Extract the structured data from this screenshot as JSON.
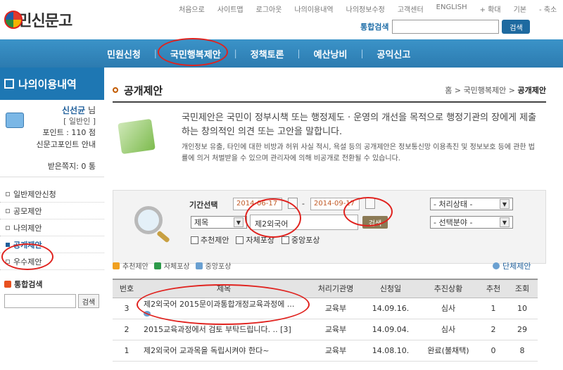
{
  "header": {
    "logo": "국민신문고",
    "util_links": [
      "처음으로",
      "사이트맵",
      "로그아웃",
      "나의이용내역",
      "나의정보수정",
      "고객센터",
      "ENGLISH",
      "+ 확대",
      "기본",
      "- 축소"
    ],
    "search_label": "통합검색",
    "search_button": "검색"
  },
  "gnb": [
    "민원신청",
    "국민행복제안",
    "정책토론",
    "예산낭비",
    "공익신고"
  ],
  "sidebar": {
    "title": "나의이용내역",
    "user_name": "신선균",
    "user_suffix": "님",
    "level": "[ 일반인 ]",
    "points": "포인트 : 110 점",
    "point_info": "신문고포인트 안내",
    "messages": "받은쪽지: 0 통",
    "menu": [
      "일반제안신청",
      "공모제안",
      "나의제안",
      "공개제안",
      "우수제안"
    ],
    "search_label": "통합검색",
    "search_button": "검색"
  },
  "main": {
    "title": "공개제안",
    "breadcrumb": [
      "홈",
      "국민행복제안",
      "공개제안"
    ],
    "lead": "국민제안은 국민이 정부시책 또는 행정제도 · 운영의 개선을 목적으로 행정기관의 장에게 제출하는 창의적인 의견 또는 고안을 말합니다.",
    "note": "개인정보 유출, 타인에 대한 비방과 허위 사실 적시, 욕설 등의 공개제안은 정보통신망 이용촉진 및 정보보호 등에 관한 법률에 의거 처벌받을 수 있으며 관리자에 의해 비공개로 전환될 수 있습니다."
  },
  "filter": {
    "period_label": "기간선택",
    "date_from": "2014-06-17",
    "date_to": "2014-09-17",
    "field_select": "제목",
    "keyword": "제2외국어",
    "search_button": "검색",
    "status_select": "- 처리상태 -",
    "category_select": "- 선택분야 -",
    "checkboxes": [
      "추천제안",
      "자체포상",
      "중앙포상"
    ]
  },
  "legend": {
    "items": [
      "추천제안",
      "자체포상",
      "중앙포상"
    ],
    "colors": [
      "#f0a020",
      "#2d9a4a",
      "#6aa0d1"
    ],
    "group_link": "단체제안"
  },
  "table": {
    "headers": [
      "번호",
      "제목",
      "처리기관명",
      "신청일",
      "추진상황",
      "추천",
      "조회"
    ],
    "rows": [
      {
        "no": "3",
        "title": "제2외국어 2015문이과통합개정교육과정에 ...",
        "org": "교육부",
        "date": "14.09.16.",
        "status": "심사",
        "rec": "1",
        "views": "10"
      },
      {
        "no": "2",
        "title": "2015교육과정에서 검토 부탁드립니다. .. [3]",
        "org": "교육부",
        "date": "14.09.04.",
        "status": "심사",
        "rec": "2",
        "views": "29"
      },
      {
        "no": "1",
        "title": "제2외국어 교과목을 독립시켜야 한다~",
        "org": "교육부",
        "date": "14.08.10.",
        "status": "완료(불채택)",
        "rec": "0",
        "views": "8"
      }
    ]
  }
}
